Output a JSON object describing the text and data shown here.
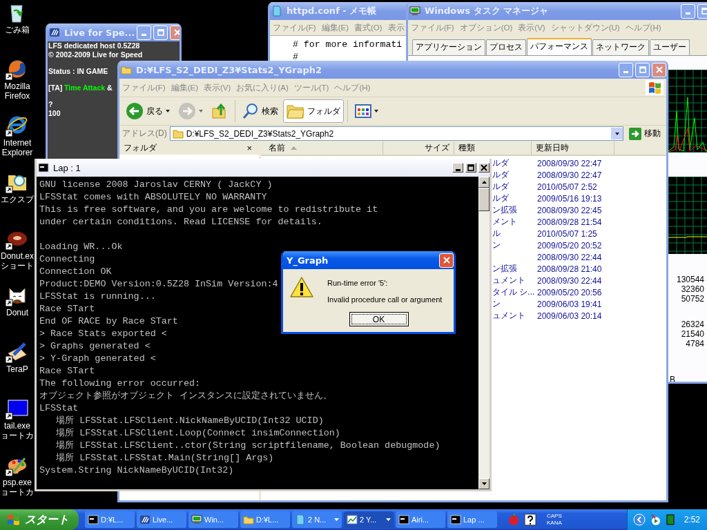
{
  "desktop_icons": [
    {
      "lines": [
        "ごみ箱"
      ],
      "shortcut": false
    },
    {
      "lines": [
        "Mozilla",
        "Firefox"
      ],
      "shortcut": true
    },
    {
      "lines": [
        "Internet",
        "Explorer"
      ],
      "shortcut": true
    },
    {
      "lines": [
        "エクスプ"
      ],
      "shortcut": true
    },
    {
      "lines": [
        "Donut.ex",
        "ショート"
      ],
      "shortcut": true
    },
    {
      "lines": [
        "Donut"
      ],
      "shortcut": true
    },
    {
      "lines": [
        "TeraP"
      ],
      "shortcut": true
    },
    {
      "lines": [
        "tail.exe",
        "ョートカ"
      ],
      "shortcut": true
    },
    {
      "lines": [
        "psp.exe",
        "ョートカ"
      ],
      "shortcut": true
    }
  ],
  "lfs_window": {
    "title": "Live for Spe...",
    "active": false,
    "blocks": [
      [
        [
          {
            "text": "LFS dedicated host 0.5Z28",
            "highlighted": false
          }
        ],
        [
          {
            "text": "© 2002-2009 Live for Speed",
            "highlighted": false
          }
        ]
      ],
      [
        [
          {
            "text": "Status : IN GAME",
            "highlighted": false
          }
        ]
      ],
      [
        [
          {
            "text": "[TA] ",
            "highlighted": false
          },
          {
            "text": "Time Attack",
            "highlighted": true
          },
          {
            "text": " &",
            "highlighted": false
          }
        ]
      ],
      [
        [
          {
            "text": "?",
            "highlighted": false
          }
        ],
        [
          {
            "text": "100",
            "highlighted": false
          }
        ]
      ]
    ]
  },
  "notepad_window": {
    "title": "httpd.conf - メモ帳",
    "active": false,
    "menu": [
      "ファイル(F)",
      "編集(E)",
      "書式(O)",
      "表示"
    ],
    "lines": [
      "# for more informati",
      "#"
    ]
  },
  "task_manager": {
    "title": "Windows タスク マネージャ",
    "active": false,
    "menu": [
      "ファイル(F)",
      "オプション(O)",
      "表示(V)",
      "シャットダウン(U)",
      "ヘルプ(H)"
    ],
    "tabs": [
      {
        "label": "アプリケーション",
        "selected": false
      },
      {
        "label": "プロセス",
        "selected": false
      },
      {
        "label": "パフォーマンス",
        "selected": true
      },
      {
        "label": "ネットワーク",
        "selected": false
      },
      {
        "label": "ユーザー",
        "selected": false
      }
    ],
    "value_groups": [
      [
        "130544",
        "32360",
        "50752"
      ],
      [
        "26324",
        "21540",
        "4784"
      ]
    ],
    "label_fragment": "B"
  },
  "explorer": {
    "title": "D:¥LFS_S2_DEDI_Z3¥Stats2_YGraph2",
    "active": false,
    "menu": [
      "ファイル(F)",
      "編集(E)",
      "表示(V)",
      "お気に入り(A)",
      "ツール(T)",
      "ヘルプ(H)"
    ],
    "toolbar": [
      {
        "kind": "back",
        "label": "戻る",
        "pressed": false,
        "disabled": false
      },
      {
        "kind": "forward",
        "pressed": false,
        "disabled": true
      },
      {
        "kind": "up",
        "pressed": false,
        "disabled": false
      },
      {
        "kind": "search",
        "label": "検索",
        "pressed": false,
        "disabled": false
      },
      {
        "kind": "folders",
        "label": "フォルダ",
        "pressed": true,
        "disabled": false
      },
      {
        "kind": "views",
        "pressed": false,
        "disabled": false
      }
    ],
    "address_label": "アドレス(D)",
    "address": "D:¥LFS_S2_DEDI_Z3¥Stats2_YGraph2",
    "go_label": "移動",
    "folder_pane_title": "フォルダ",
    "folder_pane_close": "×",
    "columns": [
      {
        "label": "名前",
        "sorted": true
      },
      {
        "label": "サイズ",
        "sorted": false
      },
      {
        "label": "種類",
        "sorted": false
      },
      {
        "label": "更新日時",
        "sorted": false
      }
    ],
    "rows": [
      {
        "type": "ルダ",
        "modified": "2008/09/30 22:47"
      },
      {
        "type": "ルダ",
        "modified": "2008/09/30 22:47"
      },
      {
        "type": "ルダ",
        "modified": "2010/05/07 2:52"
      },
      {
        "type": "ルダ",
        "modified": "2009/05/16 19:13"
      },
      {
        "type": "ン拡張",
        "modified": "2008/09/30 22:45"
      },
      {
        "type": "メント",
        "modified": "2008/09/28 21:54"
      },
      {
        "type": "ル",
        "modified": "2010/05/07 1:25"
      },
      {
        "type": "ン",
        "modified": "2009/05/20 20:52"
      },
      {
        "modified": "2008/09/30 22:44"
      },
      {
        "type": "ン拡張",
        "modified": "2008/09/28 21:40"
      },
      {
        "type": "ュメント",
        "modified": "2008/09/30 22:44"
      },
      {
        "type": "タイル シ...",
        "modified": "2009/05/20 20:56"
      },
      {
        "type": "ン",
        "modified": "2009/06/03 19:41"
      },
      {
        "type": "ュメント",
        "modified": "2009/06/03 20:14"
      }
    ]
  },
  "console": {
    "title": "Lap : 1",
    "active": false,
    "blocks": [
      [
        "GNU license 2008 Jaroslav CERNY ( JackCY )",
        "LFSStat comes with ABSOLUTELY NO WARRANTY",
        "This is free software, and you are welcome to redistribute it",
        "under certain conditions. Read LICENSE for details."
      ],
      [
        "Loading WR...Ok",
        "Connecting",
        "Connection OK",
        "Product:DEMO Version:0.5Z28 InSim Version:4",
        "LFSStat is running...",
        "Race STart",
        "End OF RACE by Race STart",
        "> Race Stats exported <",
        "> Graphs generated <",
        "> Y-Graph generated <",
        "Race STart",
        "The following error occurred:",
        "オブジェクト参照がオブジェクト インスタンスに設定されていません。",
        "LFSStat",
        "   場所 LFSStat.LFSClient.NickNameByUCID(Int32 UCID)",
        "   場所 LFSStat.LFSClient.Loop(Connect insimConnection)",
        "   場所 LFSStat.LFSClient..ctor(String scriptfilename, Boolean debugmode)",
        "   場所 LFSStat.LFSStat.Main(String[] Args)",
        "System.String NickNameByUCID(Int32)"
      ]
    ]
  },
  "dialog": {
    "title": "Y_Graph",
    "active": true,
    "messages": [
      "Run-time error '5':",
      "Invalid procedure call or argument"
    ],
    "button": "OK"
  },
  "taskbar": {
    "start_label": "スタート",
    "items": [
      {
        "label": "D:¥L...",
        "grouped": false,
        "selected": false
      },
      {
        "label": "Live...",
        "grouped": false,
        "selected": false
      },
      {
        "label": "Win...",
        "grouped": false,
        "selected": false
      },
      {
        "label": "D:¥L...",
        "grouped": false,
        "selected": false
      },
      {
        "label": "2 N...",
        "grouped": true,
        "selected": false
      },
      {
        "label": "2 Y...",
        "grouped": true,
        "selected": true
      },
      {
        "label": "Airi...",
        "grouped": false,
        "selected": false
      },
      {
        "label": "Lap ...",
        "grouped": false,
        "selected": false
      }
    ],
    "caps": "CAPS",
    "kana": "KANA",
    "clock": "2:52"
  }
}
